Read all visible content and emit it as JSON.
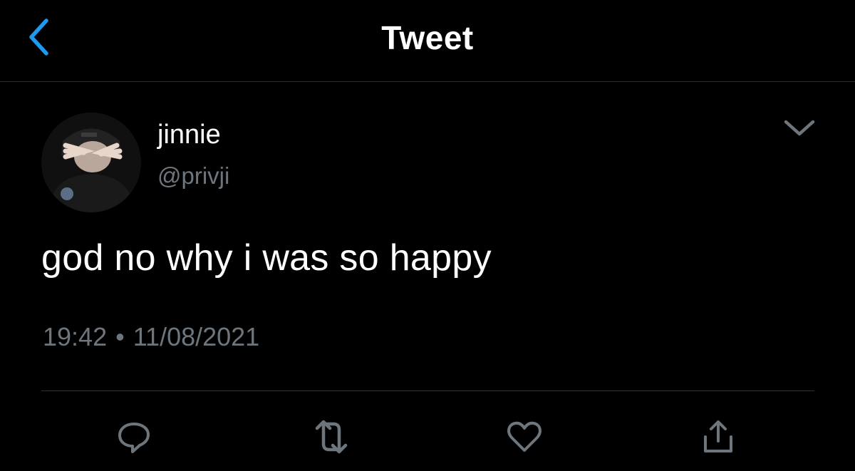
{
  "nav": {
    "title": "Tweet",
    "back_icon": "chevron-left-icon"
  },
  "tweet": {
    "display_name": "jinnie",
    "handle": "@privji",
    "text": "god no why i was so happy",
    "time": "19:42",
    "separator": "•",
    "date": "11/08/2021",
    "caret_icon": "chevron-down-icon"
  },
  "actions": [
    {
      "name": "reply",
      "icon": "reply-icon"
    },
    {
      "name": "retweet",
      "icon": "retweet-icon"
    },
    {
      "name": "like",
      "icon": "heart-icon"
    },
    {
      "name": "share",
      "icon": "share-icon"
    }
  ],
  "colors": {
    "background": "#000000",
    "accent": "#1d9bf0",
    "text_primary": "#ffffff",
    "text_secondary": "#6e767d",
    "divider": "#2f3336"
  }
}
